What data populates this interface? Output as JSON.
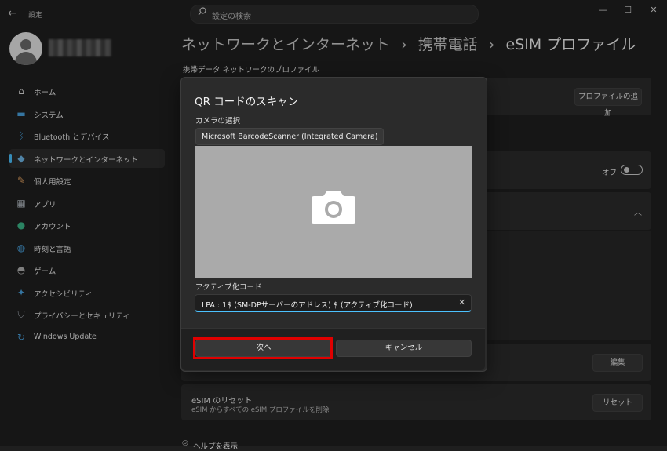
{
  "titlebar": {
    "back": "←",
    "app_title": "設定",
    "search_placeholder": "設定の検索",
    "min": "—",
    "max": "☐",
    "close": "✕"
  },
  "sidebar": {
    "items": [
      {
        "label": "ホーム",
        "icon": "home-icon"
      },
      {
        "label": "システム",
        "icon": "system-icon"
      },
      {
        "label": "Bluetooth とデバイス",
        "icon": "bluetooth-icon"
      },
      {
        "label": "ネットワークとインターネット",
        "icon": "network-icon",
        "active": true
      },
      {
        "label": "個人用設定",
        "icon": "brush-icon"
      },
      {
        "label": "アプリ",
        "icon": "apps-icon"
      },
      {
        "label": "アカウント",
        "icon": "account-icon"
      },
      {
        "label": "時刻と言語",
        "icon": "globe-clock-icon"
      },
      {
        "label": "ゲーム",
        "icon": "gamepad-icon"
      },
      {
        "label": "アクセシビリティ",
        "icon": "accessibility-icon"
      },
      {
        "label": "プライバシーとセキュリティ",
        "icon": "shield-icon"
      },
      {
        "label": "Windows Update",
        "icon": "update-icon"
      }
    ]
  },
  "main": {
    "breadcrumb": [
      "ネットワークとインターネット",
      "携帯電話",
      "eSIM プロファイル"
    ],
    "separator": "›",
    "section_label": "携帯データ ネットワークのプロファイル",
    "add_profile_button": "プロファイルの追加",
    "toggle_label": "オフ",
    "chevron_up": "︿",
    "edit_button": "編集",
    "reset_title": "eSIM のリセット",
    "reset_desc": "eSIM からすべての eSIM プロファイルを削除",
    "reset_button": "リセット",
    "help_link": "ヘルプを表示"
  },
  "dialog": {
    "title": "QR コードのスキャン",
    "camera_label": "カメラの選択",
    "camera_value": "Microsoft BarcodeScanner (Integrated Camera)",
    "code_label": "アクティブ化コード",
    "code_value": "LPA : 1$ (SM-DPサーバーのアドレス) $ (アクティブ化コード)",
    "clear": "✕",
    "next_button": "次へ",
    "cancel_button": "キャンセル"
  },
  "colors": {
    "accent": "#4cc2ff",
    "highlight": "#e00000",
    "preview": "#aaaaaa"
  }
}
